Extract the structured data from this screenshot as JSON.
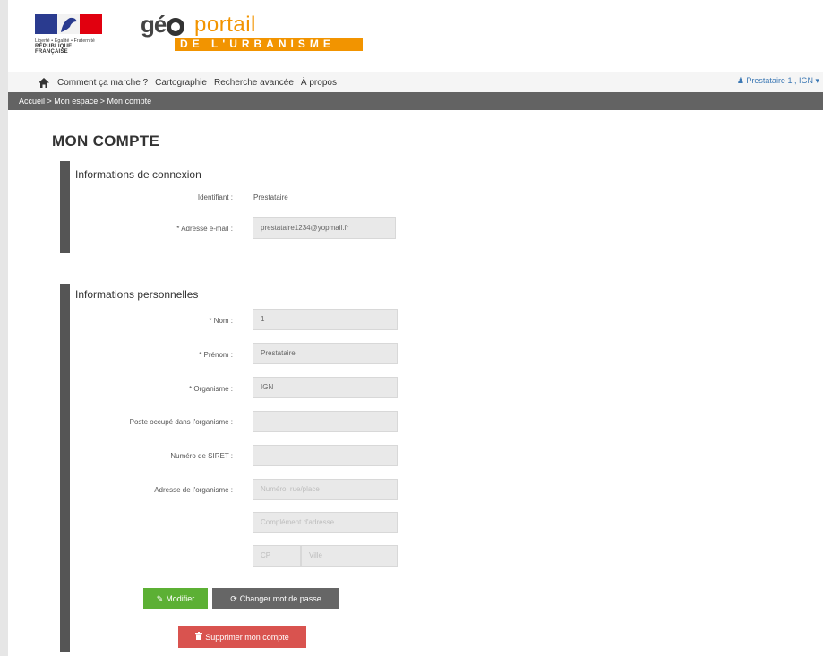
{
  "header": {
    "republique_lines": [
      "Liberté • Égalité • Fraternité",
      "RÉPUBLIQUE FRANÇAISE"
    ],
    "logo": {
      "geo": "gé",
      "portail": "portail",
      "banner": "DE L'URBANISME"
    }
  },
  "navbar": {
    "items": [
      "Comment ça marche ?",
      "Cartographie",
      "Recherche avancée",
      "À propos"
    ],
    "user": "Prestataire 1 , IGN"
  },
  "breadcrumb": "Accueil  >  Mon espace  >  Mon compte",
  "page_title": "MON COMPTE",
  "connexion": {
    "title": "Informations de connexion",
    "identifiant_label": "Identifiant :",
    "identifiant_value": "Prestataire",
    "email_label": "* Adresse e-mail :",
    "email_value": "prestataire1234@yopmail.fr"
  },
  "personnelles": {
    "title": "Informations personnelles",
    "nom_label": "* Nom :",
    "nom_value": "1",
    "prenom_label": "* Prénom :",
    "prenom_value": "Prestataire",
    "organisme_label": "* Organisme :",
    "organisme_value": "IGN",
    "poste_label": "Poste occupé dans l'organisme :",
    "poste_value": "",
    "siret_label": "Numéro de SIRET :",
    "siret_value": "",
    "adresse_label": "Adresse de l'organisme :",
    "adresse_placeholder": "Numéro, rue/place",
    "complement_placeholder": "Complément d'adresse",
    "cp_placeholder": "CP",
    "ville_placeholder": "Ville"
  },
  "buttons": {
    "modifier": "Modifier",
    "changer_mdp": "Changer mot de passe",
    "supprimer": "Supprimer mon compte"
  }
}
